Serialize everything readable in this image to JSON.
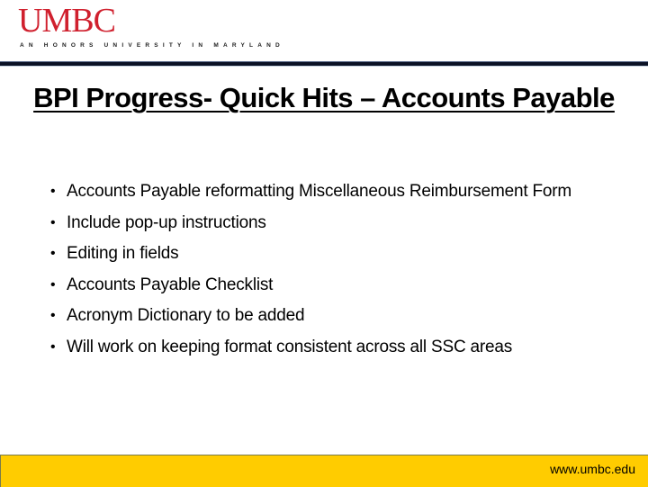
{
  "header": {
    "logo_wordmark": "UMBC",
    "logo_tagline": "AN HONORS UNIVERSITY IN MARYLAND",
    "brand_color": "#d0202e"
  },
  "slide": {
    "title": "BPI Progress- Quick Hits – Accounts Payable",
    "bullet_icon": "bullet-dot",
    "bullets": [
      "Accounts Payable reformatting Miscellaneous Reimbursement Form",
      "Include pop-up instructions",
      "Editing in fields",
      "Accounts Payable Checklist",
      "Acronym Dictionary to be added",
      "Will work on keeping format consistent across all SSC areas"
    ]
  },
  "footer": {
    "url": "www.umbc.edu",
    "background_color": "#ffcc00"
  }
}
